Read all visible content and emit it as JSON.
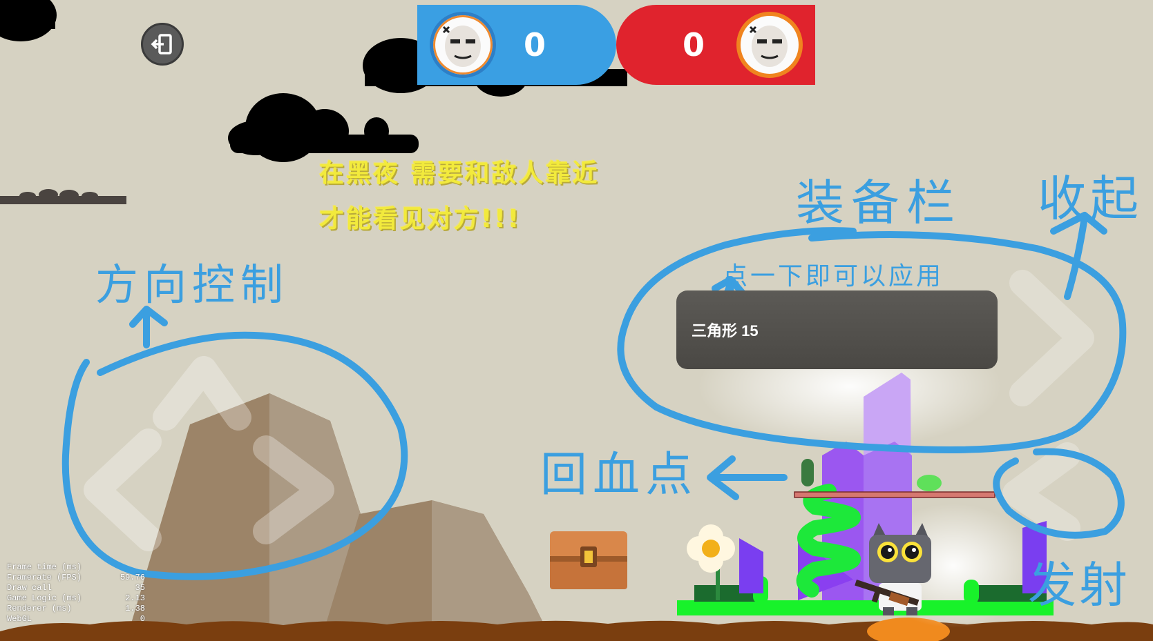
{
  "hud": {
    "blue_score": "0",
    "red_score": "0",
    "exit_icon": "exit-icon"
  },
  "hint": {
    "line1": "在黑夜 需要和敌人靠近",
    "line2": "才能看见对方!!!"
  },
  "annotations": {
    "direction_control": "方向控制",
    "equipment_bar": "装备栏",
    "collapse": "收起",
    "tap_to_apply": "点一下即可以应用",
    "heal_point": "回血点",
    "fire": "发射"
  },
  "equipment": {
    "item_label": "三角形 15"
  },
  "debug": {
    "rows": [
      {
        "label": "Frame time (ms)",
        "value": ""
      },
      {
        "label": "Framerate (FPS)",
        "value": "59.76"
      },
      {
        "label": "Draw call",
        "value": "35"
      },
      {
        "label": "Game Logic (ms)",
        "value": "2.13"
      },
      {
        "label": "Renderer (ms)",
        "value": "1.38"
      },
      {
        "label": "WebGL",
        "value": "0"
      }
    ]
  },
  "colors": {
    "background": "#d6d2c2",
    "blue_team": "#3a9fe3",
    "red_team": "#e0232d",
    "annotation": "#3b9fe0",
    "hint_text": "#f2ea3c",
    "ground": "#7a3e0f",
    "platform_green": "#18f22a",
    "crystal_purple": "#8a3ff0"
  }
}
